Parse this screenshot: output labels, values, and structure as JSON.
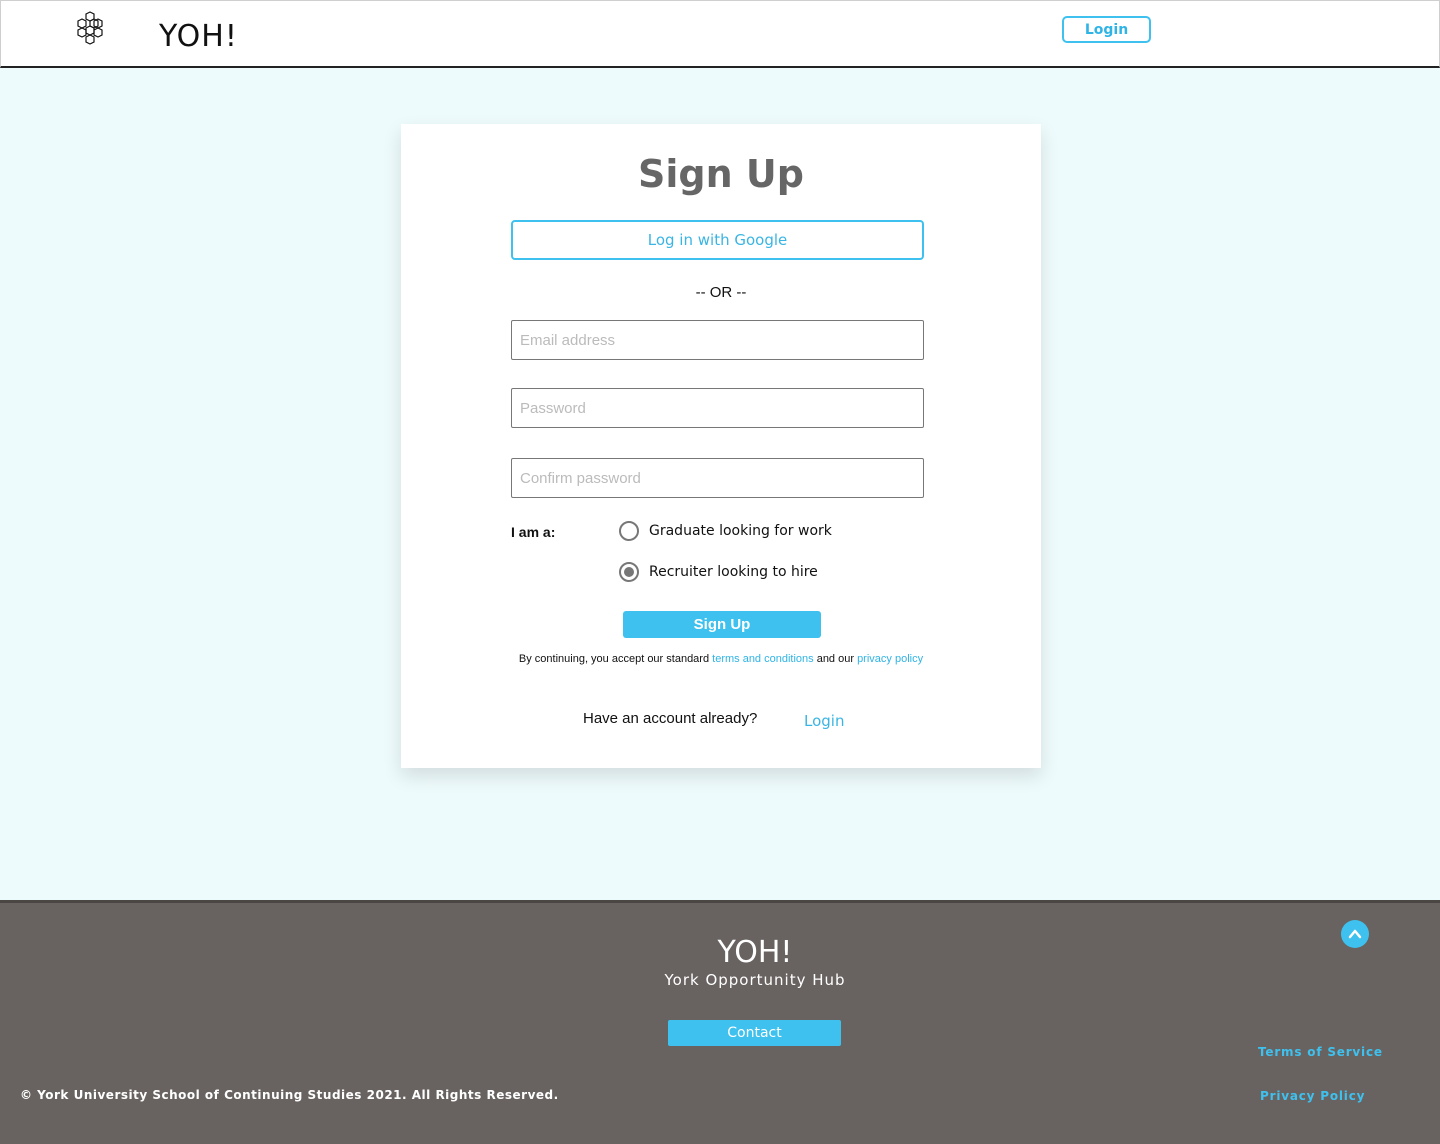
{
  "header": {
    "brand": "YOH!",
    "login_label": "Login",
    "logo_icon": "honeycomb-icon"
  },
  "signup": {
    "title": "Sign Up",
    "google_label": "Log in with Google",
    "or_label": "-- OR --",
    "email_placeholder": "Email address",
    "password_placeholder": "Password",
    "confirm_placeholder": "Confirm password",
    "role_label": "I am a:",
    "roles": [
      {
        "label": "Graduate looking for work",
        "selected": false
      },
      {
        "label": "Recruiter looking to hire",
        "selected": true
      }
    ],
    "submit_label": "Sign Up",
    "terms_prefix": "By continuing, you accept our standard ",
    "terms_link": "terms and conditions",
    "terms_middle": " and our ",
    "privacy_link": "privacy policy",
    "have_account": "Have an account already?",
    "login_link": "Login"
  },
  "footer": {
    "brand": "YOH!",
    "subtitle": "York Opportunity Hub",
    "contact_label": "Contact",
    "copyright": "© York University School of Continuing Studies 2021. All Rights Reserved.",
    "terms_of_service": "Terms of Service",
    "privacy_policy": "Privacy Policy",
    "scroll_icon": "chevron-up-icon"
  },
  "colors": {
    "accent": "#3ec1ee",
    "page_bg": "#eefbfc",
    "footer_bg": "#686361"
  }
}
